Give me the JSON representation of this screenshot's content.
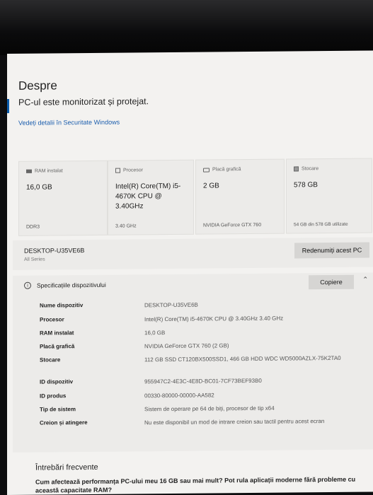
{
  "page": {
    "title": "Despre",
    "subtitle": "PC-ul este monitorizat și protejat.",
    "security_link": "Vedeți detalii în Securitate Windows"
  },
  "cards": [
    {
      "icon": "ram-icon",
      "label": "RAM instalat",
      "value": "16,0 GB",
      "footer": "DDR3"
    },
    {
      "icon": "processor-icon",
      "label": "Procesor",
      "value": "Intel(R) Core(TM) i5-4670K CPU @ 3.40GHz",
      "footer": "3.40 GHz"
    },
    {
      "icon": "graphics-card-icon",
      "label": "Placă grafică",
      "value": "2 GB",
      "footer": "NVIDIA GeForce GTX 760"
    },
    {
      "icon": "storage-icon",
      "label": "Stocare",
      "value": "578 GB",
      "footer": "54 GB din 578 GB utilizate"
    }
  ],
  "device": {
    "name": "DESKTOP-U35VE6B",
    "series": "All Series",
    "rename_label": "Redenumiți acest PC"
  },
  "specs": {
    "title": "Specificațiile dispozitivului",
    "copy_label": "Copiere",
    "rows": [
      {
        "key": "Nume dispozitiv",
        "value": "DESKTOP-U35VE6B"
      },
      {
        "key": "Procesor",
        "value": "Intel(R) Core(TM) i5-4670K CPU @ 3.40GHz   3.40 GHz"
      },
      {
        "key": "RAM instalat",
        "value": "16,0 GB"
      },
      {
        "key": "Placă grafică",
        "value": "NVIDIA GeForce GTX 760 (2 GB)"
      },
      {
        "key": "Stocare",
        "value": "112 GB SSD CT120BX500SSD1, 466 GB HDD WDC WD5000AZLX-75K2TA0"
      },
      {
        "key": "ID dispozitiv",
        "value": "955947C2-4E3C-4E8D-BC01-7CF73BEF93B0"
      },
      {
        "key": "ID produs",
        "value": "00330-80000-00000-AA582"
      },
      {
        "key": "Tip de sistem",
        "value": "Sistem de operare pe 64 de biți, procesor de tip x64"
      },
      {
        "key": "Creion și atingere",
        "value": "Nu este disponibil un mod de intrare creion sau tactil pentru acest ecran"
      }
    ]
  },
  "faq": {
    "title": "Întrebări frecvente",
    "question": "Cum afectează performanța PC-ului meu 16 GB sau mai mult? Pot rula aplicații moderne fără probleme cu această capacitate RAM?"
  }
}
